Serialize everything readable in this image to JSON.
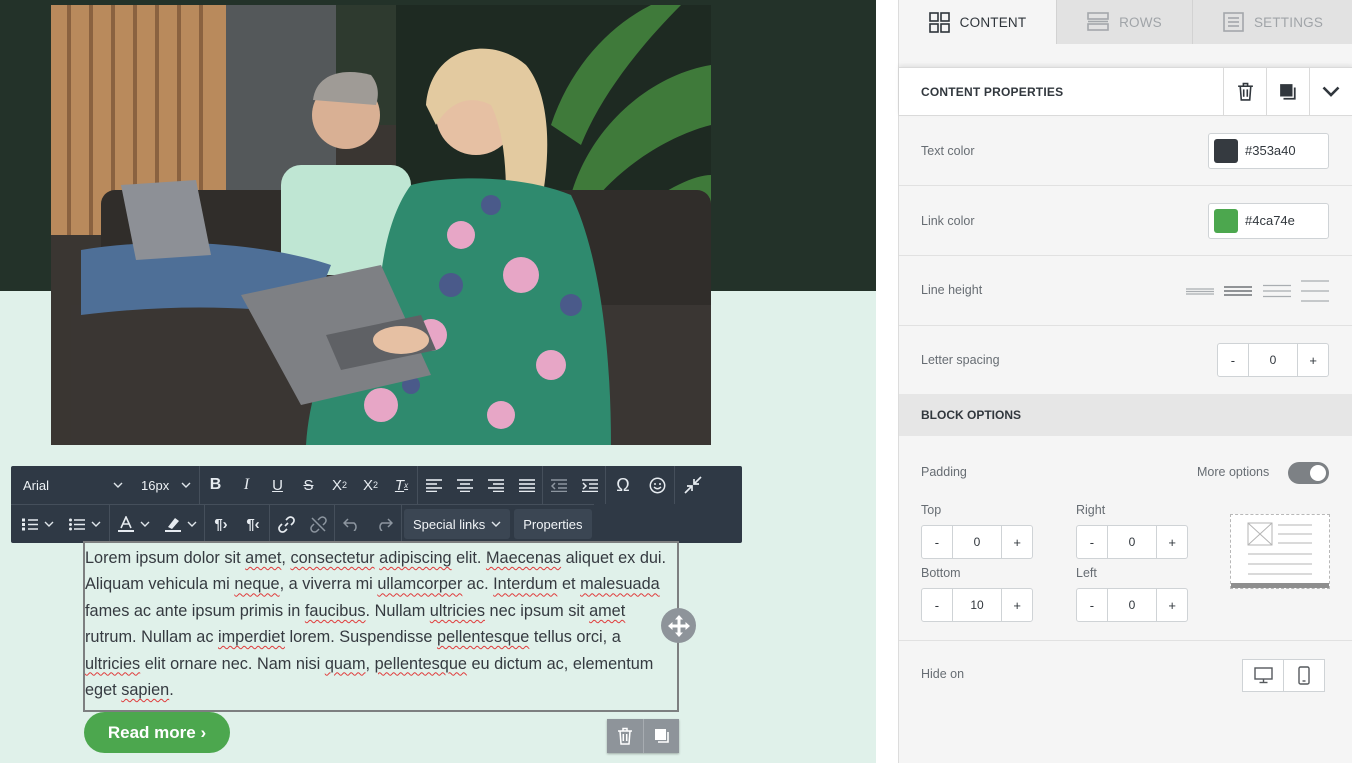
{
  "editor": {
    "text_block": {
      "segments": [
        {
          "t": "Lorem ipsum dolor sit "
        },
        {
          "t": "amet",
          "sq": true
        },
        {
          "t": ", "
        },
        {
          "t": "consectetur",
          "sq": true
        },
        {
          "t": " "
        },
        {
          "t": "adipiscing",
          "sq": true
        },
        {
          "t": " elit. "
        },
        {
          "t": "Maecenas",
          "sq": true
        },
        {
          "t": " aliquet ex dui. Aliquam vehicula mi "
        },
        {
          "t": "neque",
          "sq": true
        },
        {
          "t": ", a viverra mi "
        },
        {
          "t": "ullamcorper",
          "sq": true
        },
        {
          "t": " ac. "
        },
        {
          "t": "Interdum",
          "sq": true
        },
        {
          "t": " et "
        },
        {
          "t": "malesuada",
          "sq": true
        },
        {
          "t": " fames ac ante ipsum primis in "
        },
        {
          "t": "faucibus",
          "sq": true
        },
        {
          "t": ". Nullam "
        },
        {
          "t": "ultricies",
          "sq": true
        },
        {
          "t": " nec ipsum sit "
        },
        {
          "t": "amet",
          "sq": true
        },
        {
          "t": " rutrum. Nullam ac "
        },
        {
          "t": "imperdiet",
          "sq": true
        },
        {
          "t": " lorem. Suspendisse "
        },
        {
          "t": "pellentesque",
          "sq": true
        },
        {
          "t": " tellus orci, a "
        },
        {
          "t": "ultricies",
          "sq": true
        },
        {
          "t": " elit ornare nec. Nam nisi "
        },
        {
          "t": "quam",
          "sq": true
        },
        {
          "t": ", "
        },
        {
          "t": "pellentesque",
          "sq": true
        },
        {
          "t": " eu dictum ac, elementum eget "
        },
        {
          "t": "sapien",
          "sq": true
        },
        {
          "t": "."
        }
      ]
    },
    "button_label": "Read more ›",
    "toolbar": {
      "font_family": "Arial",
      "font_size": "16px",
      "special_links": "Special links",
      "properties": "Properties"
    }
  },
  "panel": {
    "tabs": [
      {
        "label": "CONTENT",
        "icon": "grid-icon",
        "active": true
      },
      {
        "label": "ROWS",
        "icon": "rows-icon",
        "active": false
      },
      {
        "label": "SETTINGS",
        "icon": "settings-icon",
        "active": false
      }
    ],
    "content_properties": {
      "title": "CONTENT PROPERTIES",
      "text_color": {
        "label": "Text color",
        "value": "#353a40"
      },
      "link_color": {
        "label": "Link color",
        "value": "#4ca74e"
      },
      "line_height": {
        "label": "Line height"
      },
      "letter_spacing": {
        "label": "Letter spacing",
        "value": "0",
        "minus": "-",
        "plus": "+"
      }
    },
    "block_options": {
      "title": "BLOCK OPTIONS",
      "padding_label": "Padding",
      "more_options": "More options",
      "more_options_on": true,
      "top": {
        "label": "Top",
        "value": "0"
      },
      "right": {
        "label": "Right",
        "value": "0"
      },
      "bottom": {
        "label": "Bottom",
        "value": "10"
      },
      "left": {
        "label": "Left",
        "value": "0"
      },
      "minus": "-",
      "plus": "+",
      "hide_on": "Hide on"
    }
  },
  "colors": {
    "accent_green": "#4ca74e",
    "text_dark": "#353a40",
    "hero_dark": "#233229",
    "canvas_mint": "#e0f1ea",
    "toolbar_bg": "#2f3945"
  }
}
